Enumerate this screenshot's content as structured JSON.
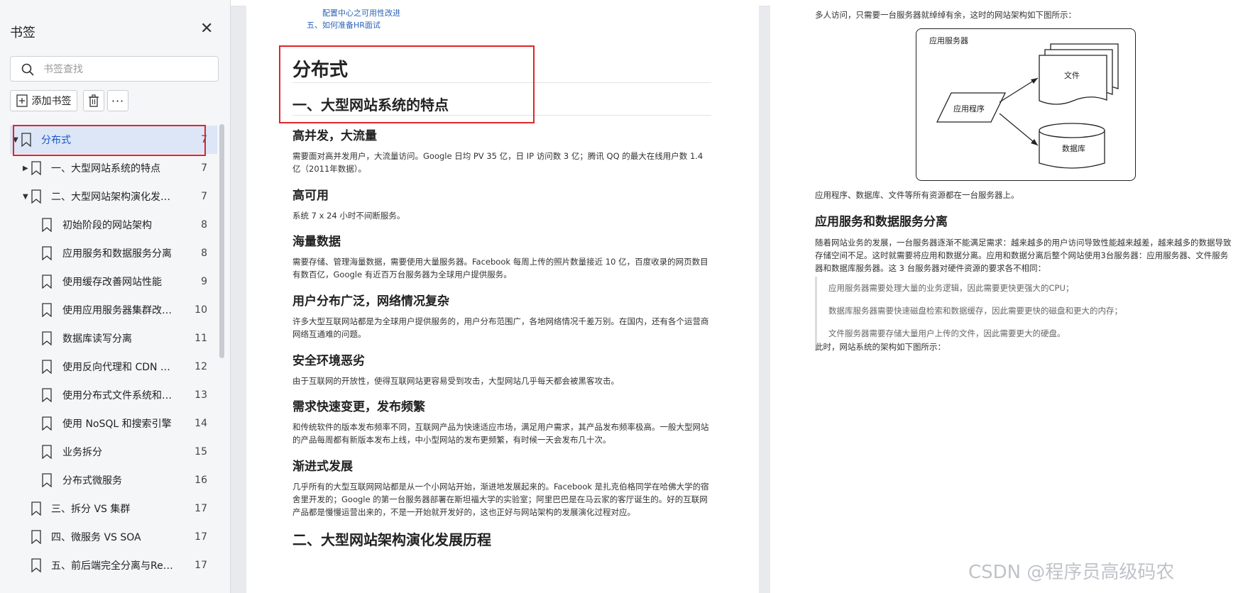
{
  "sidebar": {
    "title": "书签",
    "search_placeholder": "书签查找",
    "add_label": "添加书签",
    "more_label": "···",
    "items": [
      {
        "label": "分布式",
        "page": "7"
      },
      {
        "label": "一、大型网站系统的特点",
        "page": "7"
      },
      {
        "label": "二、大型网站架构演化发…",
        "page": "7"
      },
      {
        "label": "初始阶段的网站架构",
        "page": "8"
      },
      {
        "label": "应用服务和数据服务分离",
        "page": "8"
      },
      {
        "label": "使用缓存改善网站性能",
        "page": "9"
      },
      {
        "label": "使用应用服务器集群改…",
        "page": "10"
      },
      {
        "label": "数据库读写分离",
        "page": "11"
      },
      {
        "label": "使用反向代理和 CDN …",
        "page": "12"
      },
      {
        "label": "使用分布式文件系统和…",
        "page": "13"
      },
      {
        "label": "使用 NoSQL 和搜索引擎",
        "page": "14"
      },
      {
        "label": "业务拆分",
        "page": "15"
      },
      {
        "label": "分布式微服务",
        "page": "16"
      },
      {
        "label": "三、拆分 VS 集群",
        "page": "17"
      },
      {
        "label": "四、微服务 VS SOA",
        "page": "17"
      },
      {
        "label": "五、前后端完全分离与Re…",
        "page": "17"
      }
    ]
  },
  "page1": {
    "toc": [
      "配置中心之可用性改进",
      "五、如何准备HR面试"
    ],
    "title": "分布式",
    "section1": "一、大型网站系统的特点",
    "blocks": [
      {
        "heading": "高并发，大流量",
        "text": "需要面对高并发用户，大流量访问。Google 日均 PV 35 亿，日 IP 访问数 3 亿；腾讯 QQ 的最大在线用户数 1.4 亿（2011年数据）。"
      },
      {
        "heading": "高可用",
        "text": "系统 7 x 24 小时不间断服务。"
      },
      {
        "heading": "海量数据",
        "text": "需要存储、管理海量数据，需要使用大量服务器。Facebook 每周上传的照片数量接近 10 亿，百度收录的网页数目有数百亿，Google 有近百万台服务器为全球用户提供服务。"
      },
      {
        "heading": "用户分布广泛，网络情况复杂",
        "text": "许多大型互联网站都是为全球用户提供服务的，用户分布范围广，各地网络情况千差万别。在国内，还有各个运营商网络互通难的问题。"
      },
      {
        "heading": "安全环境恶劣",
        "text": "由于互联网的开放性，使得互联网站更容易受到攻击，大型网站几乎每天都会被黑客攻击。"
      },
      {
        "heading": "需求快速变更，发布频繁",
        "text": "和传统软件的版本发布频率不同，互联网产品为快速适应市场，满足用户需求，其产品发布频率极高。一般大型网站的产品每周都有新版本发布上线，中小型网站的发布更频繁，有时候一天会发布几十次。"
      },
      {
        "heading": "渐进式发展",
        "text": "几乎所有的大型互联网网站都是从一个小网站开始，渐进地发展起来的。Facebook 是扎克伯格同学在哈佛大学的宿舍里开发的；Google 的第一台服务器部署在斯坦福大学的实验室；阿里巴巴是在马云家的客厅诞生的。好的互联网产品都是慢慢运营出来的，不是一开始就开发好的，这也正好与网站架构的发展演化过程对应。"
      }
    ],
    "section2": "二、大型网站架构演化发展历程"
  },
  "page2": {
    "intro": "多人访问，只需要一台服务器就绰绰有余，这时的网站架构如下图所示：",
    "diagram": {
      "container": "应用服务器",
      "app": "应用程序",
      "file": "文件",
      "db": "数据库"
    },
    "after_diagram": "应用程序、数据库、文件等所有资源都在一台服务器上。",
    "heading": "应用服务和数据服务分离",
    "para": "随着网站业务的发展，一台服务器逐渐不能满足需求：越来越多的用户访问导致性能越来越差，越来越多的数据导致存储空间不足。这时就需要将应用和数据分离。应用和数据分离后整个网站使用3台服务器：应用服务器、文件服务器和数据库服务器。这 3 台服务器对硬件资源的要求各不相同：",
    "quotes": [
      "应用服务器需要处理大量的业务逻辑，因此需要更快更强大的CPU；",
      "数据库服务器需要快速磁盘检索和数据缓存，因此需要更快的磁盘和更大的内存；",
      "文件服务器需要存储大量用户上传的文件，因此需要更大的硬盘。"
    ],
    "closing": "此时，网站系统的架构如下图所示："
  },
  "watermark": "CSDN @程序员高级码农"
}
